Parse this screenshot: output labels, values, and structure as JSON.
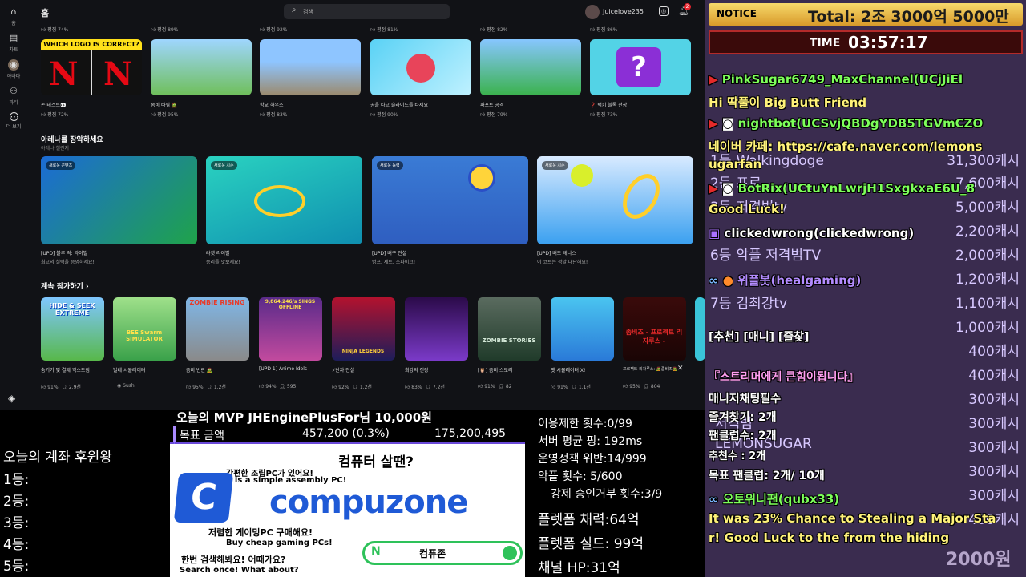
{
  "app": {
    "title": "홈",
    "search_placeholder": "검색",
    "username": "Juicelove235",
    "notification_count": "2",
    "rail": [
      {
        "icon": "home-icon",
        "glyph": "⌂",
        "label": "홈"
      },
      {
        "icon": "chart-icon",
        "glyph": "▤",
        "label": "차트"
      },
      {
        "icon": "avatar-icon",
        "glyph": "◉",
        "label": "아바타"
      },
      {
        "icon": "people-icon",
        "glyph": "⚇",
        "label": "파티"
      },
      {
        "icon": "more-icon",
        "glyph": "⋯",
        "label": "더 보기"
      }
    ],
    "top_stats": [
      "평점 74%",
      "평점 89%",
      "평점 92%",
      "평점 81%",
      "평점 82%",
      "평점 86%"
    ],
    "row1": [
      {
        "name": "논 테스트👀",
        "stat": "평점 72%",
        "banner": "WHICH LOGO IS CORRECT?"
      },
      {
        "name": "좀비 타워 🧟",
        "stat": "평점 95%"
      },
      {
        "name": "학교 하우스",
        "stat": "평점 83%"
      },
      {
        "name": "공을 타고 슬라이드를 타세요",
        "stat": "평점 90%"
      },
      {
        "name": "파프트 공격",
        "stat": "평점 79%"
      },
      {
        "name": "❓ 럭키 블록 전장",
        "stat": "평점 73%"
      }
    ],
    "arena": {
      "title": "아레나를 장악하세요",
      "subtitle": "아레나 챌린지",
      "cards": [
        {
          "badge": "새로운 콘텐츠",
          "title": "[UPD] 블루 락: 라이벌",
          "desc": "최고의 실력을 증명하세요!"
        },
        {
          "badge": "새로운 시즌",
          "title": "라켓 라이벌",
          "desc": "승리를 맛보세요!"
        },
        {
          "badge": "새로운 능력",
          "title": "[UPD] 배구 전설",
          "desc": "범프, 세트, 스파이크!"
        },
        {
          "badge": "새로운 시즌",
          "title": "[UPD] 배드 테니스",
          "desc": "이 코트는 정말 대단해요!"
        }
      ]
    },
    "continue": {
      "title": "계속 참가하기",
      "chevron": "›",
      "items": [
        {
          "name": "숨기기 및 결제 익스트림",
          "stat": "91%",
          "extra": "2.9천",
          "art": "HIDE & SEEK EXTREME"
        },
        {
          "name": "벌레 시뮬레이터",
          "stat": "",
          "extra": "Sushi",
          "art": "BEE Swarm SIMULATOR"
        },
        {
          "name": "좀비 반란 🧟",
          "stat": "95%",
          "extra": "1.2천",
          "art": "ZOMBIE RISING"
        },
        {
          "name": "[UPD 1] Anime Idols",
          "stat": "94%",
          "extra": "595",
          "art": "9,864,246/s SINGS OFFLINE"
        },
        {
          "name": "⚡닌자 전설",
          "stat": "92%",
          "extra": "1.2천",
          "art": "NINJA LEGENDS"
        },
        {
          "name": "최강의 전장",
          "stat": "83%",
          "extra": "7.2천",
          "art": ""
        },
        {
          "name": "[🦉] 좀비 스토리",
          "stat": "91%",
          "extra": "82",
          "art": "ZOMBIE STORIES"
        },
        {
          "name": "펫 시뮬레이터 X!",
          "stat": "91%",
          "extra": "1.1천",
          "art": ""
        },
        {
          "name": "프로젝트 리자루스: 🧟좀비즈🧟",
          "stat": "95%",
          "extra": "804",
          "art": "좀비즈 - 프로젝트 리자루스 -"
        }
      ]
    }
  },
  "donors": {
    "title": "오늘의 계좌 후원왕",
    "ranks": [
      "1등:",
      "2등:",
      "3등:",
      "4등:",
      "5등:"
    ]
  },
  "goal": {
    "mvp": "오늘의 MVP JHEnginePlusFor님 10,000원",
    "label": "목표 금액",
    "current": "457,200 (0.3%)",
    "target": "175,200,495",
    "ad_question": "컴퓨터 살땐?",
    "ad_line1": "간편한 조립PC가 있어요!",
    "ad_line1_en": "There is a simple assembly PC!",
    "brand": "compuzone",
    "ad_line2": "저렴한 게이밍PC 구매해요!",
    "ad_line2_en": "Buy cheap gaming PCs!",
    "ad_line3": "한번 검색해봐요! 어때가요?",
    "ad_line3_en": "Search once! What about?",
    "search_brand": "컴퓨존",
    "search_n": "N"
  },
  "stats": [
    "이용제한 횟수:0/99",
    "서버 평균 핑: 192ms",
    "운영정책 위반:14/999",
    "악플 횟수: 5/600",
    "강제 승인거부 횟수:3/9",
    "플렛폼 채력:64억",
    "플렛폼 실드: 99억",
    "채널 HP:31억"
  ],
  "notice": {
    "label": "NOTICE",
    "total": "Total: 2조 3000억 5000만",
    "time_label": "TIME",
    "time": "03:57:17"
  },
  "ranking": [
    {
      "rank": "1등",
      "name": "Walkingdoge",
      "amount": "31,300캐시"
    },
    {
      "rank": "2등",
      "name": "프로",
      "amount": "7,600캐시"
    },
    {
      "rank": "3등",
      "name": "저격범tv",
      "amount": "5,000캐시"
    },
    {
      "rank": "",
      "name": "",
      "amount": "2,200캐시"
    },
    {
      "rank": "6등",
      "name": "악플 저격범TV",
      "amount": "2,000캐시"
    },
    {
      "rank": "",
      "name": "",
      "amount": "1,200캐시"
    },
    {
      "rank": "7등",
      "name": "김최강tv",
      "amount": "1,100캐시"
    },
    {
      "rank": "",
      "name": "",
      "amount": "1,000캐시"
    },
    {
      "rank": "",
      "name": "",
      "amount": "400캐시"
    },
    {
      "rank": "",
      "name": "",
      "amount": "400캐시"
    },
    {
      "rank": "",
      "name": "",
      "amount": "300캐시"
    },
    {
      "rank": "",
      "name": "저격범",
      "amount": "300캐시"
    },
    {
      "rank": "",
      "name": "LEMONSUGAR",
      "amount": "300캐시"
    },
    {
      "rank": "",
      "name": "",
      "amount": "300캐시"
    },
    {
      "rank": "",
      "name": "",
      "amount": "300캐시"
    },
    {
      "rank": "",
      "name": "",
      "amount": "400캐시"
    }
  ],
  "chat": [
    {
      "platform": "youtube",
      "text": "PinkSugar6749_MaxChannel(UCjJiEl",
      "color": "#7dff5a"
    },
    {
      "platform": "",
      "text": "Hi 딱풀이 Big Butt Friend",
      "color": "#fff27a"
    },
    {
      "platform": "youtube",
      "text": "nightbot(UCSvjQBDgYDB5TGVmCZO",
      "color": "#7dff5a"
    },
    {
      "platform": "",
      "text": "네이버 카페: https://cafe.naver.com/lemons",
      "color": "#fff27a"
    },
    {
      "platform": "",
      "text": "ugarfan",
      "color": "#fff27a"
    },
    {
      "platform": "youtube",
      "text": "BotRix(UCtuYnLwrjH1SxgkxaE6U_8",
      "color": "#7dff5a"
    },
    {
      "platform": "",
      "text": "Good Luck!",
      "color": "#fff27a"
    },
    {
      "platform": "twitch",
      "text": "clickedwrong(clickedwrong)",
      "color": "#ffffff"
    },
    {
      "platform": "",
      "text": "위플봇(healgaming)",
      "color": "#b48cff"
    },
    {
      "platform": "",
      "text": "[추천] [매니] [즐찾]",
      "color": "#ffffff"
    },
    {
      "platform": "",
      "text": "『스트리머에게 큰힘이됩니다』",
      "color": "#ff9ef0"
    },
    {
      "platform": "",
      "text": "매니저채팅필수",
      "color": "#ffffff"
    },
    {
      "platform": "",
      "text": "즐겨찾기: 2개",
      "color": "#ffffff"
    },
    {
      "platform": "",
      "text": "팬클럽수: 2개",
      "color": "#ffffff"
    },
    {
      "platform": "",
      "text": "추천수 : 2개",
      "color": "#ffffff"
    },
    {
      "platform": "",
      "text": "목표 팬클럽: 2개/ 10개",
      "color": "#ffffff"
    },
    {
      "platform": "",
      "text": "오토위니팬(qubx33)",
      "color": "#7dff5a"
    },
    {
      "platform": "",
      "text": "It was 23% Chance to Stealing a Major Sta",
      "color": "#fff27a"
    },
    {
      "platform": "",
      "text": "r! Good Luck to the from the hiding",
      "color": "#fff27a"
    }
  ],
  "chat_footer": "2000원",
  "colors": {
    "accent": "#e7242d",
    "green": "#7dff5a",
    "purple": "#3a2c4f",
    "yellow": "#fff27a"
  }
}
